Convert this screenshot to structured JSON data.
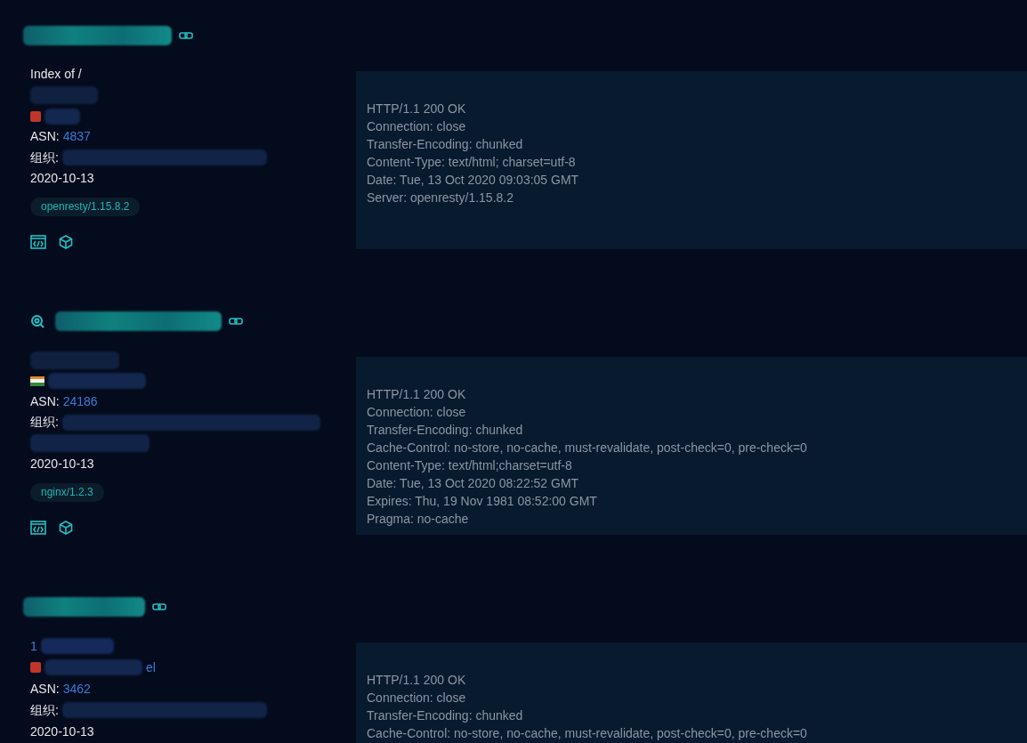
{
  "results": [
    {
      "search_icon": false,
      "lines": [
        {
          "kind": "text",
          "text": "Index of /"
        },
        {
          "kind": "redacted"
        },
        {
          "kind": "location-red"
        }
      ],
      "asn_label": "ASN:",
      "asn": "4837",
      "org_label": "组织:",
      "org_extra_line": false,
      "date": "2020-10-13",
      "tag": "openresty/1.15.8.2",
      "headers": [
        "HTTP/1.1 200 OK",
        "Connection: close",
        "Transfer-Encoding: chunked",
        "Content-Type: text/html; charset=utf-8",
        "Date: Tue, 13 Oct 2020 09:03:05 GMT",
        "Server: openresty/1.15.8.2"
      ]
    },
    {
      "search_icon": true,
      "lines": [
        {
          "kind": "redacted"
        },
        {
          "kind": "location-tricolor"
        }
      ],
      "asn_label": "ASN:",
      "asn": "24186",
      "org_label": "组织:",
      "org_extra_line": true,
      "date": "2020-10-13",
      "tag": "nginx/1.2.3",
      "headers": [
        "HTTP/1.1 200 OK",
        "Connection: close",
        "Transfer-Encoding: chunked",
        "Cache-Control: no-store, no-cache, must-revalidate, post-check=0, pre-check=0",
        "Content-Type: text/html;charset=utf-8",
        "Date: Tue, 13 Oct 2020 08:22:52 GMT",
        "Expires: Thu, 19 Nov 1981 08:52:00 GMT",
        "Pragma: no-cache"
      ]
    },
    {
      "search_icon": false,
      "lines": [
        {
          "kind": "link",
          "text": "1"
        },
        {
          "kind": "location-red",
          "text": "el"
        }
      ],
      "asn_label": "ASN:",
      "asn": "3462",
      "org_label": "组织:",
      "org_extra_line": false,
      "date": "2020-10-13",
      "headers": [
        "HTTP/1.1 200 OK",
        "Connection: close",
        "Transfer-Encoding: chunked",
        "Cache-Control: no-store, no-cache, must-revalidate, post-check=0, pre-check=0"
      ]
    }
  ]
}
